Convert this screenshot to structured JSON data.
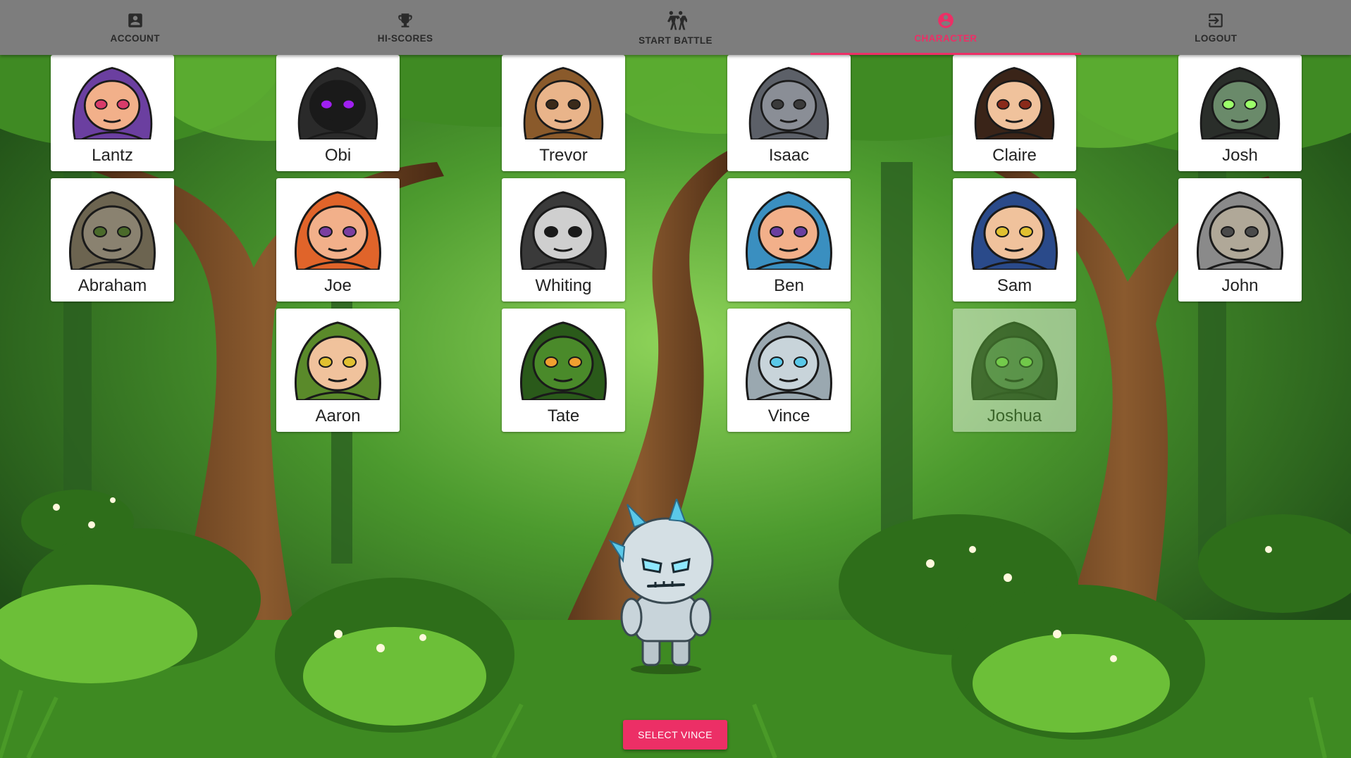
{
  "nav": {
    "tabs": [
      {
        "label": "ACCOUNT",
        "icon": "account-box-icon",
        "active": false
      },
      {
        "label": "HI-SCORES",
        "icon": "trophy-icon",
        "active": false
      },
      {
        "label": "START BATTLE",
        "icon": "battle-icon",
        "active": false
      },
      {
        "label": "CHARACTER",
        "icon": "account-circle-icon",
        "active": true
      },
      {
        "label": "LOGOUT",
        "icon": "logout-icon",
        "active": false
      }
    ]
  },
  "characters": [
    {
      "name": "Lantz",
      "type": "purple-wizard",
      "hood": "#6b3fa0",
      "skin": "#f2b08a",
      "accent": "#d83b6a",
      "selectable": true
    },
    {
      "name": "Obi",
      "type": "shadow-wraith",
      "hood": "#2a2a2a",
      "skin": "#1a1a1a",
      "accent": "#a020f0",
      "selectable": true
    },
    {
      "name": "Trevor",
      "type": "bearded-barbarian",
      "hood": "#8a5a2b",
      "skin": "#e9b48a",
      "accent": "#3a2a1a",
      "selectable": true
    },
    {
      "name": "Isaac",
      "type": "horned-brute",
      "hood": "#5c6068",
      "skin": "#8a8e96",
      "accent": "#3a3a3a",
      "selectable": true
    },
    {
      "name": "Claire",
      "type": "pirate",
      "hood": "#3a2418",
      "skin": "#f0c29c",
      "accent": "#8a2a1a",
      "selectable": true
    },
    {
      "name": "Josh",
      "type": "skull-reaper",
      "hood": "#2a2e2a",
      "skin": "#6a8a6a",
      "accent": "#9cff6a",
      "selectable": true
    },
    {
      "name": "Abraham",
      "type": "stone-golem",
      "hood": "#6c6450",
      "skin": "#8a8270",
      "accent": "#4a6a2a",
      "selectable": true
    },
    {
      "name": "Joe",
      "type": "fire-wizard",
      "hood": "#e0642a",
      "skin": "#f2b08a",
      "accent": "#7a3fa0",
      "selectable": true
    },
    {
      "name": "Whiting",
      "type": "hooded-rogue",
      "hood": "#3a3a3a",
      "skin": "#cfcfcf",
      "accent": "#1a1a1a",
      "selectable": true
    },
    {
      "name": "Ben",
      "type": "ice-wizard",
      "hood": "#3a8fc0",
      "skin": "#f2b08a",
      "accent": "#6a3fa0",
      "selectable": true
    },
    {
      "name": "Sam",
      "type": "mage-apprentice",
      "hood": "#2a4a8a",
      "skin": "#f0c29c",
      "accent": "#e0c030",
      "selectable": true
    },
    {
      "name": "John",
      "type": "crowned-knight",
      "hood": "#8a8a8a",
      "skin": "#b0a898",
      "accent": "#4a4a4a",
      "selectable": true
    },
    {
      "name": "Aaron",
      "type": "elf-archer",
      "hood": "#5a8a2a",
      "skin": "#f0c29c",
      "accent": "#e0c030",
      "selectable": true
    },
    {
      "name": "Tate",
      "type": "orc",
      "hood": "#2a5a1a",
      "skin": "#4a8a2a",
      "accent": "#f0a030",
      "selectable": true
    },
    {
      "name": "Vince",
      "type": "ice-golem",
      "hood": "#9aa8b0",
      "skin": "#c8d4da",
      "accent": "#5ac8e8",
      "selectable": true
    },
    {
      "name": "Joshua",
      "type": "skull-reaper-locked",
      "hood": "#2a2e2a",
      "skin": "#6a8a6a",
      "accent": "#9cff6a",
      "selectable": false
    }
  ],
  "selected": {
    "name": "Vince",
    "type": "ice-golem"
  },
  "select_button_label": "SELECT VINCE",
  "colors": {
    "accent": "#ec2f66",
    "navbar": "#7d7d7d",
    "card": "#ffffff"
  }
}
